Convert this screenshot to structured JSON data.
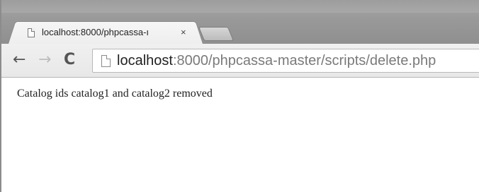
{
  "tab": {
    "title": "localhost:8000/phpcassa-ı",
    "close_glyph": "×",
    "favicon": "page-icon"
  },
  "toolbar": {
    "back_glyph": "←",
    "forward_glyph": "→",
    "reload_glyph": "C",
    "address": {
      "host": "localhost",
      "rest": ":8000/phpcassa-master/scripts/delete.php",
      "icon": "page-icon"
    }
  },
  "page": {
    "message": "Catalog ids catalog1 and catalog2 removed"
  }
}
